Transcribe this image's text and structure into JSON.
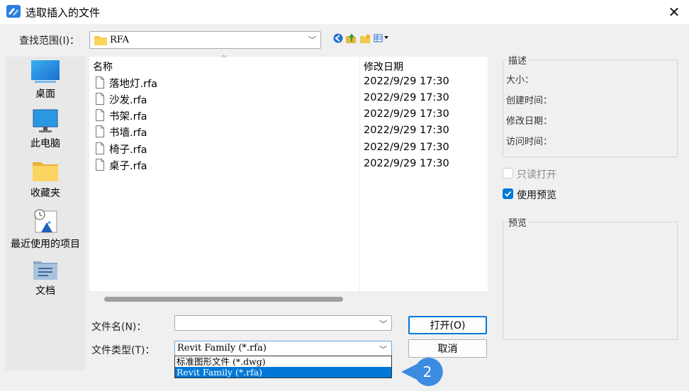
{
  "window": {
    "title": "选取插入的文件",
    "close_glyph": "✕"
  },
  "lookin": {
    "label": "查找范围(I)：",
    "value": "RFA",
    "icons": [
      "globe-back-icon",
      "up-folder-icon",
      "new-folder-icon",
      "view-menu-icon"
    ]
  },
  "places": [
    {
      "label": "桌面",
      "icon": "desktop-icon"
    },
    {
      "label": "此电脑",
      "icon": "computer-icon"
    },
    {
      "label": "收藏夹",
      "icon": "favorites-folder-icon"
    },
    {
      "label": "最近使用的项目",
      "icon": "recent-items-icon"
    },
    {
      "label": "文档",
      "icon": "documents-icon"
    }
  ],
  "filelist": {
    "col_name": "名称",
    "col_date": "修改日期",
    "sort_glyph": "^",
    "rows": [
      {
        "name": "落地灯.rfa",
        "date": "2022/9/29 17:30"
      },
      {
        "name": "沙发.rfa",
        "date": "2022/9/29 17:30"
      },
      {
        "name": "书架.rfa",
        "date": "2022/9/29 17:30"
      },
      {
        "name": "书墙.rfa",
        "date": "2022/9/29 17:30"
      },
      {
        "name": "椅子.rfa",
        "date": "2022/9/29 17:30"
      },
      {
        "name": "桌子.rfa",
        "date": "2022/9/29 17:30"
      }
    ]
  },
  "form": {
    "filename_label": "文件名(N)：",
    "filename_value": "",
    "filetype_label": "文件类型(T)：",
    "filetype_value": "Revit Family (*.rfa)",
    "filetype_options": [
      "标准图形文件 (*.dwg)",
      "Revit Family (*.rfa)"
    ],
    "filetype_selected_index": 1
  },
  "buttons": {
    "open": "打开(O)",
    "cancel": "取消"
  },
  "callout": {
    "number": "2",
    "color": "#3b8be0"
  },
  "description": {
    "title": "描述",
    "size": "大小：",
    "created": "创建时间：",
    "modified": "修改日期：",
    "accessed": "访问时间："
  },
  "options": {
    "readonly_label": "只读打开",
    "readonly_checked": false,
    "preview_label": "使用预览",
    "preview_checked": true
  },
  "preview": {
    "title": "预览"
  },
  "colors": {
    "accent": "#0078d7"
  }
}
